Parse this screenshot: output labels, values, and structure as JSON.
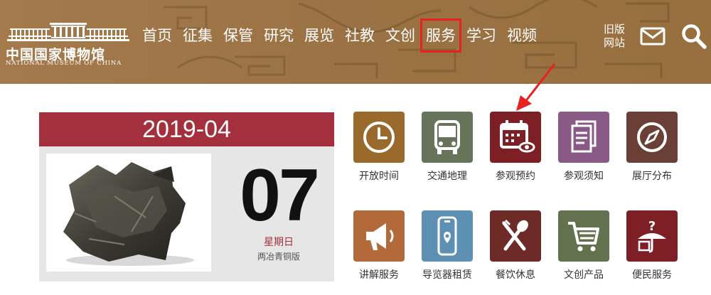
{
  "header": {
    "logo_cn": "中国国家博物馆",
    "logo_en": "NATIONAL MUSEUM OF CHINA",
    "nav": [
      "首页",
      "征集",
      "保管",
      "研究",
      "展览",
      "社教",
      "文创",
      "服务",
      "学习",
      "视频"
    ],
    "active_nav": "服务",
    "old_site_line1": "旧版",
    "old_site_line2": "网站",
    "mail_icon": "mail-icon",
    "search_icon": "search-icon"
  },
  "calendar": {
    "month": "2019-04",
    "day": "07",
    "weekday": "星期日",
    "caption": "两冶青铜版",
    "accent_color": "#a3303c"
  },
  "services": [
    {
      "label": "开放时间",
      "icon": "clock-icon",
      "color": "#9a6a2c"
    },
    {
      "label": "交通地理",
      "icon": "bus-icon",
      "color": "#66755a"
    },
    {
      "label": "参观预约",
      "icon": "calendar-eye-icon",
      "color": "#7e1f26"
    },
    {
      "label": "参观须知",
      "icon": "document-icon",
      "color": "#8a5a86"
    },
    {
      "label": "展厅分布",
      "icon": "compass-icon",
      "color": "#6a3f36"
    },
    {
      "label": "讲解服务",
      "icon": "megaphone-icon",
      "color": "#b26a3b"
    },
    {
      "label": "导览器租赁",
      "icon": "audio-guide-icon",
      "color": "#5d90b3"
    },
    {
      "label": "餐饮休息",
      "icon": "fork-spoon-icon",
      "color": "#6e2a26"
    },
    {
      "label": "文创产品",
      "icon": "cart-icon",
      "color": "#62714e"
    },
    {
      "label": "便民服务",
      "icon": "help-umbrella-icon",
      "color": "#7e1f26"
    }
  ]
}
